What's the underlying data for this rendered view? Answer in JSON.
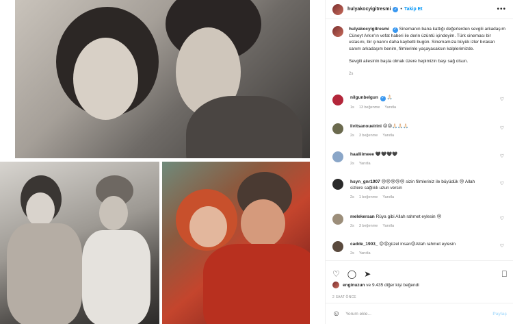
{
  "header": {
    "username": "hulyakocyigitresmi",
    "dot": "•",
    "follow": "Takip Et",
    "more": "•••"
  },
  "caption": {
    "username": "hulyakocyigitresmi",
    "text": "Sinemanın bana kattığı değerlerden sevgili arkadaşım Cüneyt Arkın'ın vefat haberi ile derin üzüntü içindeyim. Türk sineması bir ustasını, bir çınarını daha kaybetti bugün. Sinemamıza büyük izler bırakan canım arkadaşım benim, filmlerinle yaşayacaksın kalplerimizde.",
    "text2": "Sevgili ailesinin başta olmak üzere hepimizin başı sağ olsun.",
    "time": "2s"
  },
  "comments": [
    {
      "username": "nilgunbelgun",
      "verified": true,
      "text": "🙏🏻",
      "time": "1s",
      "likes": "13 beğenme",
      "reply": "Yanıtla",
      "avatar_color": "#b3263a"
    },
    {
      "username": "livitsanoueirini",
      "verified": false,
      "text": "😢😢🙏🏻🙏🏻🙏🏻",
      "time": "2s",
      "likes": "3 beğenme",
      "reply": "Yanıtla",
      "avatar_color": "#6b6a4e"
    },
    {
      "username": "haalliimeee",
      "verified": false,
      "text": "🖤🖤🖤🖤",
      "time": "2s",
      "likes": "",
      "reply": "Yanıtla",
      "avatar_color": "#8aa6c8"
    },
    {
      "username": "hsyn_gnr1907",
      "verified": false,
      "text": "😢😢😢😢😢 sizin filmleriniz ile büyüdük 😢 Allah sizlere sağlıklı uzun versin",
      "time": "2s",
      "likes": "1 beğenme",
      "reply": "Yanıtla",
      "avatar_color": "#2a2a2a"
    },
    {
      "username": "melekersan",
      "verified": false,
      "text": "Rüya gibi Allah rahmet eylesin 😢",
      "time": "2s",
      "likes": "3 beğenme",
      "reply": "Yanıtla",
      "avatar_color": "#9c8e7a"
    },
    {
      "username": "cadde_1903_",
      "verified": false,
      "text": "😢😢güzel insan😢Allah rahmet eylesin",
      "time": "2s",
      "likes": "",
      "reply": "Yanıtla",
      "avatar_color": "#5a4a3e"
    }
  ],
  "actions": {
    "like": "♡",
    "comment": "◯",
    "share": "➤",
    "save": "⎕"
  },
  "likes": {
    "text_user": "enginuzun",
    "text_rest": " ve 9.435 diğer kişi beğendi"
  },
  "ago": "2 SAAT ÖNCE",
  "add_comment": {
    "emoji": "☺",
    "placeholder": "Yorum ekle...",
    "share": "Paylaş"
  }
}
